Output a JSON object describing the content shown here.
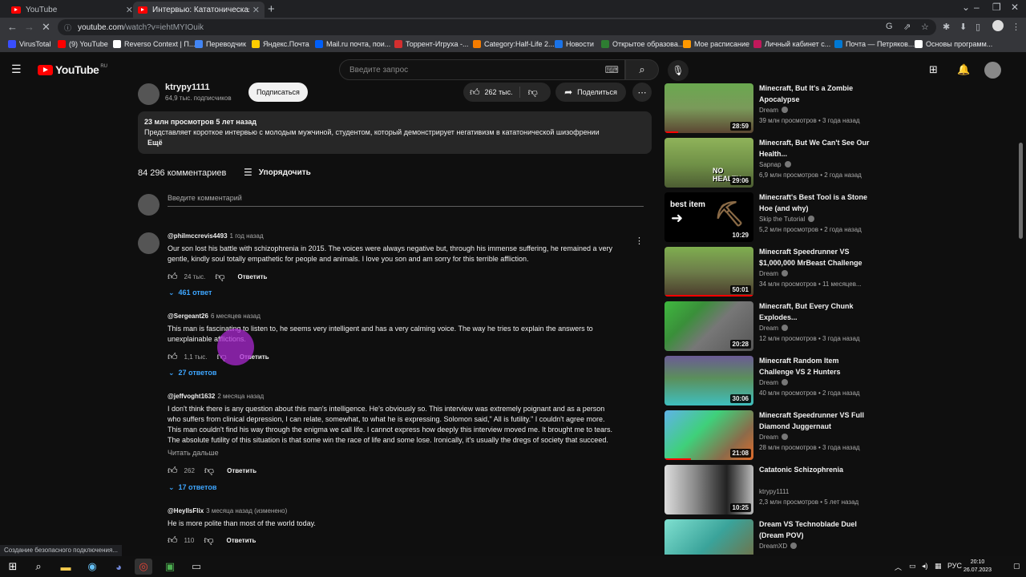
{
  "browser": {
    "tabs": [
      {
        "title": "YouTube",
        "active": false
      },
      {
        "title": "Интервью: Кататоническая Ши",
        "active": true
      }
    ],
    "url_host": "youtube.com",
    "url_path": "/watch?v=iehtMYIOuik",
    "status_text": "Создание безопасного подключения...",
    "bookmarks": [
      {
        "label": "VirusTotal",
        "color": "#394eff"
      },
      {
        "label": "(9) YouTube",
        "color": "#ff0000"
      },
      {
        "label": "Reverso Context | П...",
        "color": "#ffffff"
      },
      {
        "label": "Переводчик",
        "color": "#4285f4"
      },
      {
        "label": "Яндекс.Почта",
        "color": "#ffcc00"
      },
      {
        "label": "Mail.ru почта, пои...",
        "color": "#005ff9"
      },
      {
        "label": "Торрент-Игруха -...",
        "color": "#d32f2f"
      },
      {
        "label": "Category:Half-Life 2...",
        "color": "#f57c00"
      },
      {
        "label": "Новости",
        "color": "#1a73e8"
      },
      {
        "label": "Открытое образова...",
        "color": "#2e7d32"
      },
      {
        "label": "Мое расписание",
        "color": "#ff9800"
      },
      {
        "label": "Личный кабинет с...",
        "color": "#c2185b"
      },
      {
        "label": "Почта — Петряков...",
        "color": "#0078d4"
      },
      {
        "label": "Основы программ...",
        "color": "#ffffff"
      }
    ]
  },
  "header": {
    "logo_text": "YouTube",
    "country_code": "RU",
    "search_placeholder": "Введите запрос"
  },
  "video": {
    "channel_name": "ktrypy1111",
    "subscribers": "64,9 тыс. подписчиков",
    "subscribe_label": "Подписаться",
    "likes": "262 тыс.",
    "share_label": "Поделиться",
    "stats": "23 млн просмотров  5 лет назад",
    "description": "Представляет короткое интервью с молодым мужчиной, студентом, который демонстрирует негативизм в кататонической шизофрении",
    "more_label": "Ещё"
  },
  "comments_section": {
    "count": "84 296 комментариев",
    "sort_label": "Упорядочить",
    "add_placeholder": "Введите комментарий",
    "reply_label": "Ответить",
    "read_more": "Читать дальше",
    "comments": [
      {
        "author": "@philmccrevis4493",
        "time": "1 год назад",
        "lines": [
          "Our son lost his battle with schizophrenia in 2015. The voices were always negative but, through his immense suffering, he remained a very",
          "gentle, kindly soul totally empathetic for people and animals.   I love you son and am sorry for this terrible affliction."
        ],
        "likes": "24 тыс.",
        "replies": "461 ответ"
      },
      {
        "author": "@Sergeant26",
        "time": "6 месяцев назад",
        "lines": [
          "This man is fascinating to listen to, he seems very intelligent and has a very calming voice. The way he tries to explain the answers to",
          "unexplainable afflictions."
        ],
        "likes": "1,1 тыс.",
        "replies": "27 ответов"
      },
      {
        "author": "@jeffvoght1632",
        "time": "2 месяца назад",
        "lines": [
          "I don't think there is any question about this man's intelligence. He's obviously so. This interview was extremely poignant and as a person",
          "who suffers from clinical depression, I can relate, somewhat, to what he is expressing. Solomon said,\" All is futility.\" I couldn't agree more.",
          "This man couldn't find his way through the enigma we call life. I cannot express how deeply this interview moved me. It brought me to tears.",
          "The absolute futility of this situation is that some win the race of life and some lose. Ironically, it's usually the dregs of society that succeed."
        ],
        "likes": "262",
        "replies": "17 ответов"
      },
      {
        "author": "@HeyllsFlix",
        "time": "3 месяца назад (изменено)",
        "lines": [
          "He is more polite than most of the world today."
        ],
        "likes": "110"
      }
    ]
  },
  "recommendations": [
    {
      "title": "Minecraft, But It's a Zombie Apocalypse",
      "channel": "Dream",
      "verified": true,
      "meta": "39 млн просмотров • 3 года назад",
      "duration": "28:59",
      "progress": 0.15,
      "thumb_text": ""
    },
    {
      "title": "Minecraft, But We Can't See Our Health...",
      "channel": "Sapnap",
      "verified": true,
      "meta": "6,9 млн просмотров • 2 года назад",
      "duration": "29:06",
      "progress": 0,
      "thumb_text": "NO HEALTH"
    },
    {
      "title": "Minecraft's Best Tool is a Stone Hoe (and why)",
      "channel": "Skip the Tutorial",
      "verified": true,
      "meta": "5,2 млн просмотров • 2 года назад",
      "duration": "10:29",
      "progress": 0,
      "thumb_text": "best item"
    },
    {
      "title": "Minecraft Speedrunner VS $1,000,000 MrBeast Challenge",
      "channel": "Dream",
      "verified": true,
      "meta": "34 млн просмотров • 11 месяцев...",
      "duration": "50:01",
      "progress": 1,
      "thumb_text": ""
    },
    {
      "title": "Minecraft, But Every Chunk Explodes...",
      "channel": "Dream",
      "verified": true,
      "meta": "12 млн просмотров • 3 года назад",
      "duration": "20:28",
      "progress": 0,
      "thumb_text": ""
    },
    {
      "title": "Minecraft Random Item Challenge VS 2 Hunters",
      "channel": "Dream",
      "verified": true,
      "meta": "40 млн просмотров • 2 года назад",
      "duration": "30:06",
      "progress": 0,
      "thumb_text": ""
    },
    {
      "title": "Minecraft Speedrunner VS Full Diamond Juggernaut",
      "channel": "Dream",
      "verified": true,
      "meta": "28 млн просмотров • 3 года назад",
      "duration": "21:08",
      "progress": 0.3,
      "thumb_text": ""
    },
    {
      "title": "Catatonic Schizophrenia",
      "channel": "ktrypy1111",
      "verified": false,
      "meta": "2,3 млн просмотров • 5 лет назад",
      "duration": "10:25",
      "progress": 0,
      "thumb_text": ""
    },
    {
      "title": "Dream VS Technoblade Duel (Dream POV)",
      "channel": "DreamXD",
      "verified": true,
      "meta": "",
      "duration": "",
      "progress": 0,
      "thumb_text": ""
    }
  ],
  "taskbar": {
    "lang": "РУС",
    "time": "20:10",
    "date": "26.07.2023"
  }
}
